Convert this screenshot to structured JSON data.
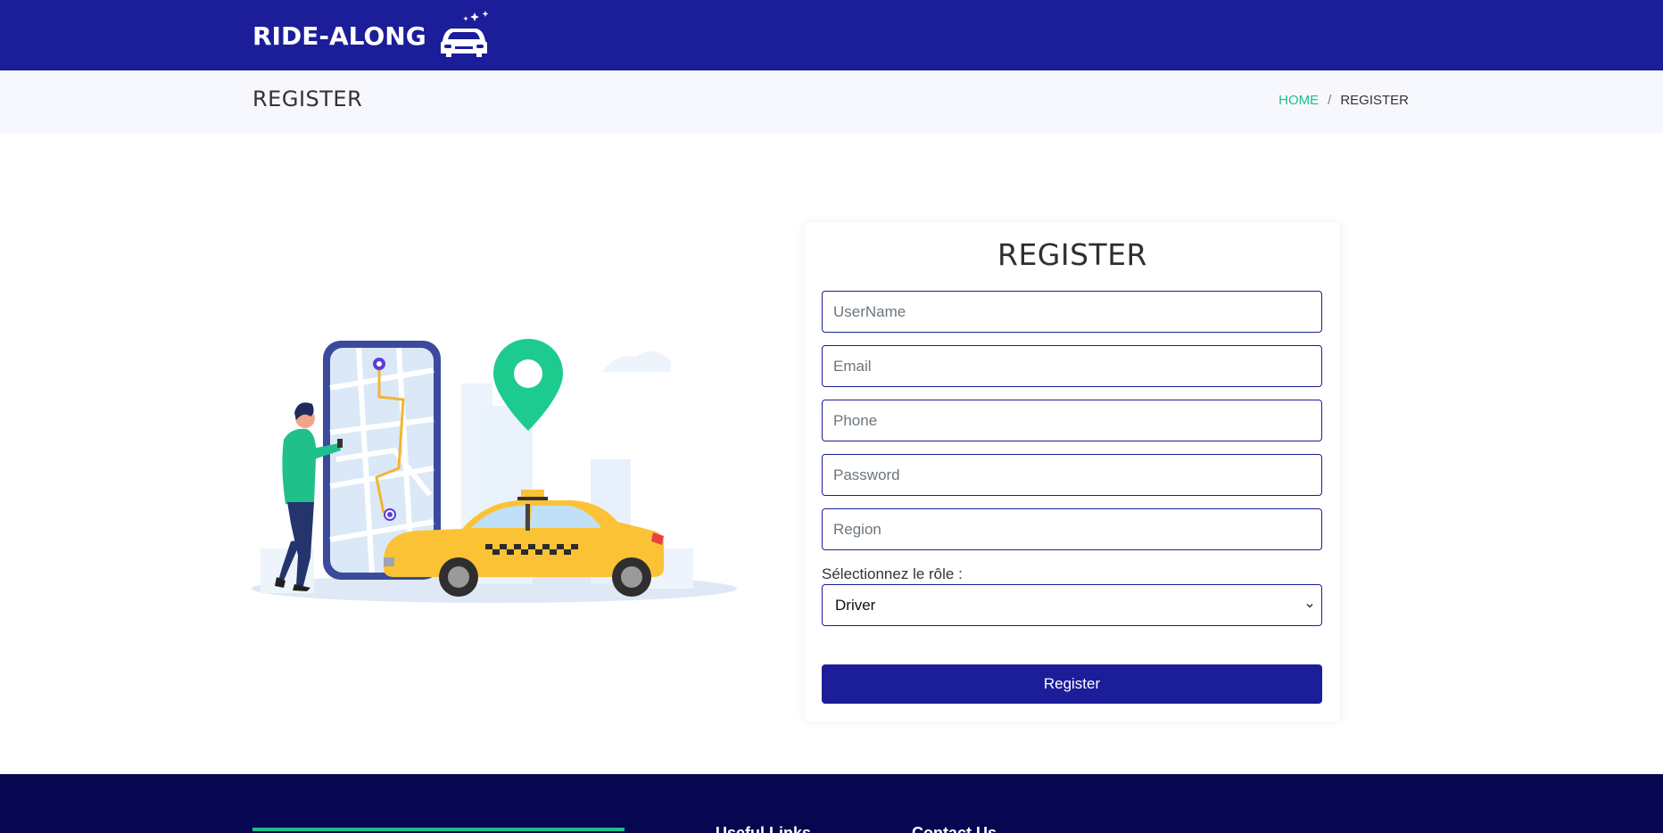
{
  "header": {
    "logo_text": "RIDE-ALONG",
    "logo_icon": "car-with-sparkles-icon"
  },
  "page": {
    "title": "REGISTER"
  },
  "breadcrumb": {
    "home": "HOME",
    "separator": "/",
    "current": "REGISTER"
  },
  "form": {
    "heading": "REGISTER",
    "username_placeholder": "UserName",
    "email_placeholder": "Email",
    "phone_placeholder": "Phone",
    "password_placeholder": "Password",
    "region_placeholder": "Region",
    "role_label": "Sélectionnez le rôle :",
    "role_selected": "Driver",
    "submit_label": "Register"
  },
  "footer": {
    "col1_heading": "Useful Links",
    "col2_heading": "Contact Us"
  },
  "colors": {
    "primary": "#1c1d99",
    "accent": "#1ebe8b",
    "footer": "#070650",
    "taxi": "#fcc236"
  }
}
